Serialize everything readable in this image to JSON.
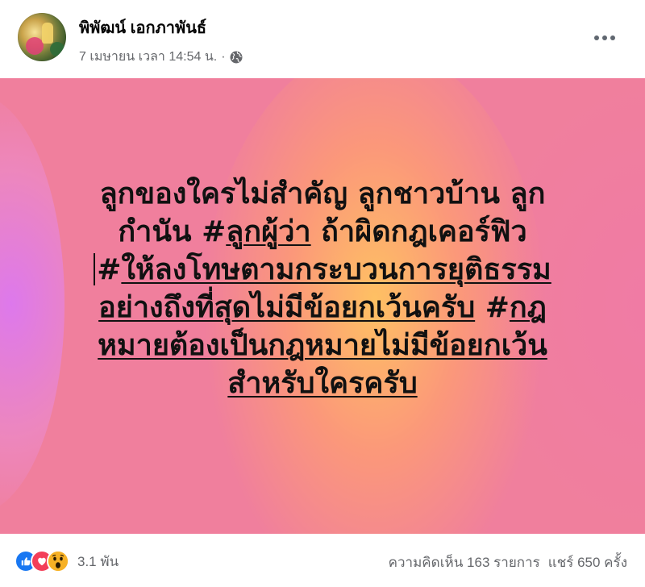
{
  "header": {
    "author_name": "พิพัฒน์ เอกภาพันธ์",
    "timestamp": "7 เมษายน เวลา 14:54 น.",
    "separator": "·",
    "privacy_icon": "globe-icon",
    "more_icon": "more-horizontal-icon"
  },
  "post": {
    "lines": [
      {
        "text": "ลูกของใครไม่สำคัญ ลูกชาวบ้าน ลูก"
      },
      {
        "pre": "กำนัน #",
        "under": "ลูกผู้ว่า",
        "post": " ถ้าผิดกฎเคอร์ฟิว"
      },
      {
        "pre": "#",
        "under": "ให้ลงโทษตามกระบวนการยุติธรรม"
      },
      {
        "under": "อย่างถึงที่สุดไม่มีข้อยกเว้นครับ",
        "mid": " #",
        "under2": "กฎ"
      },
      {
        "under": "หมายต้องเป็นกฎหมายไม่มีข้อยกเว้น"
      },
      {
        "under": "สำหรับใครครับ"
      }
    ],
    "background": {
      "base": "#f07f9d",
      "glow_orange": "#ffc460",
      "glow_violet": "#dc78f0"
    }
  },
  "footer": {
    "reaction_icons": [
      "like-icon",
      "love-icon",
      "wow-icon"
    ],
    "reaction_count": "3.1 พัน",
    "comments": "ความคิดเห็น 163 รายการ",
    "shares": "แชร์ 650 ครั้ง"
  },
  "colors": {
    "like": "#1877f2",
    "love": "#f33e58",
    "wow": "#f7b125",
    "secondary_text": "#65676b"
  }
}
